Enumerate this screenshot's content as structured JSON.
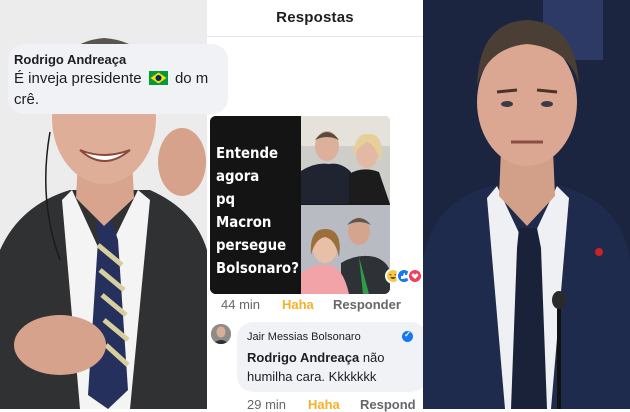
{
  "header": {
    "title": "Respostas"
  },
  "comment1": {
    "author": "Rodrigo Andreaça",
    "text_before_flag": "É inveja presidente",
    "text_after_flag": "do m",
    "text_line2": "crê.",
    "flag_icon": "brazil-flag-emoji",
    "time": "44 min",
    "reaction_label": "Haha",
    "reply_label": "Responder"
  },
  "meme": {
    "caption": "Entende\nagora\npq Macron\npersegue\nBolsonaro?"
  },
  "reactions": [
    "haha-emoji",
    "like-icon",
    "love-icon"
  ],
  "comment2": {
    "author": "Jair Messias Bolsonaro",
    "verified_icon": "verified-badge-icon",
    "mention": "Rodrigo Andreaça",
    "text_after_mention": "não",
    "text_line2": "humilha cara. Kkkkkkk",
    "time": "29 min",
    "reaction_label": "Haha",
    "reply_label": "Respond"
  },
  "colors": {
    "haha": "#f7b125",
    "bubble": "#f0f2f5",
    "meta": "#65676b",
    "verified": "#1877f2"
  }
}
